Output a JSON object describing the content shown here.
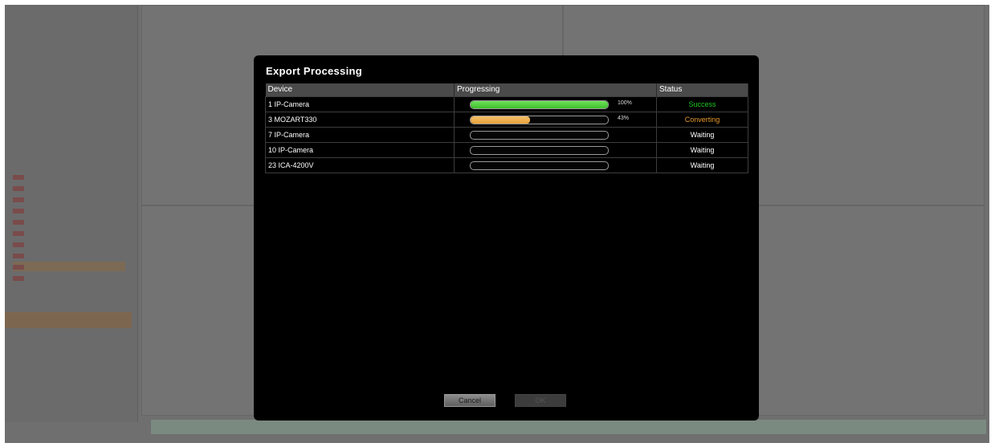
{
  "colors": {
    "success": "#1ec81e",
    "converting": "#e89a2c",
    "progress_green": "#3fbf2c",
    "progress_orange": "#e8a23a"
  },
  "dialog": {
    "title": "Export Processing",
    "columns": [
      "Device",
      "Progressing",
      "Status"
    ],
    "rows": [
      {
        "device": "1 IP-Camera",
        "progress": 100,
        "progress_label": "100%",
        "status": "Success",
        "status_kind": "success"
      },
      {
        "device": "3 MOZART330",
        "progress": 43,
        "progress_label": "43%",
        "status": "Converting",
        "status_kind": "converting"
      },
      {
        "device": "7 IP-Camera",
        "progress": 0,
        "progress_label": "",
        "status": "Waiting",
        "status_kind": "waiting"
      },
      {
        "device": "10 IP-Camera",
        "progress": 0,
        "progress_label": "",
        "status": "Waiting",
        "status_kind": "waiting"
      },
      {
        "device": "23 ICA-4200V",
        "progress": 0,
        "progress_label": "",
        "status": "Waiting",
        "status_kind": "waiting"
      }
    ],
    "cancel_label": "Cancel",
    "ok_label": "OK"
  }
}
